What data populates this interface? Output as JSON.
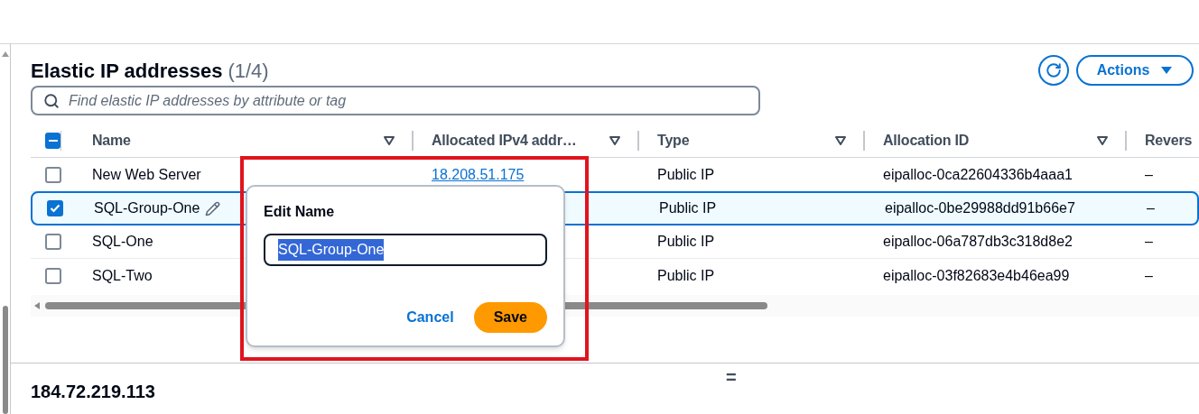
{
  "header": {
    "title": "Elastic IP addresses",
    "count": "(1/4)",
    "actions_label": "Actions"
  },
  "search": {
    "placeholder": "Find elastic IP addresses by attribute or tag"
  },
  "table": {
    "select_all": {
      "indeterminate": true
    },
    "columns": [
      "Name",
      "Allocated IPv4 addr…",
      "Type",
      "Allocation ID",
      "Revers"
    ],
    "rows": [
      {
        "name": "New Web Server",
        "selected": false,
        "ip": "18.208.51.175",
        "type": "Public IP",
        "allocation_id": "eipalloc-0ca22604336b4aaa1",
        "reverse": "–",
        "editing": false
      },
      {
        "name": "SQL-Group-One",
        "selected": true,
        "type": "Public IP",
        "allocation_id": "eipalloc-0be29988dd91b66e7",
        "reverse": "–",
        "editing": true
      },
      {
        "name": "SQL-One",
        "selected": false,
        "type": "Public IP",
        "allocation_id": "eipalloc-06a787db3c318d8e2",
        "reverse": "–",
        "editing": false
      },
      {
        "name": "SQL-Two",
        "selected": false,
        "type": "Public IP",
        "allocation_id": "eipalloc-03f82683e4b46ea99",
        "reverse": "–",
        "editing": false
      }
    ]
  },
  "edit_popover": {
    "title": "Edit Name",
    "value": "SQL-Group-One",
    "cancel": "Cancel",
    "save": "Save"
  },
  "detail": {
    "divider_handle": "=",
    "title": "184.72.219.113"
  }
}
